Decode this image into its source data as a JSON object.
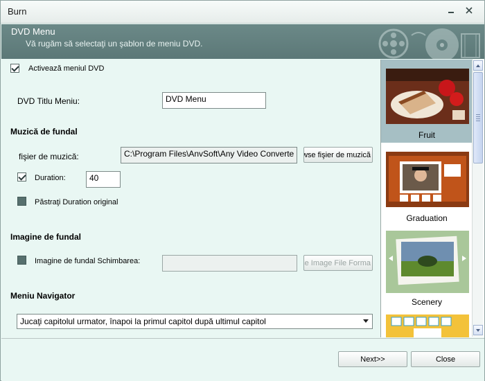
{
  "window": {
    "title": "Burn"
  },
  "header": {
    "title": "DVD Menu",
    "subtitle": "Vă rugăm să selectaţi un şablon de meniu DVD."
  },
  "enable_menu": {
    "label": "Activează meniul DVD",
    "checked": true
  },
  "menu_title": {
    "label": "DVD Titlu Meniu:",
    "value": "DVD Menu"
  },
  "music": {
    "heading": "Muzică de fundal",
    "file_label": "fişier de muzică:",
    "file_value": "C:\\Program Files\\AnvSoft\\Any Video Converte",
    "browse_label": "owse fişier de muzică",
    "duration_label": "Duration:",
    "duration_checked": true,
    "duration_value": "40",
    "keep_label": "Păstraţi Duration original",
    "keep_checked": false
  },
  "image": {
    "heading": "Imagine de fundal",
    "change_label": "Imagine de fundal Schimbarea:",
    "change_checked": false,
    "path_value": "",
    "browse_label": "owse Image File Forma"
  },
  "navigator": {
    "heading": "Meniu Navigator",
    "selected": "Jucaţi capitolul urmator, înapoi la primul capitol după ultimul capitol"
  },
  "templates": {
    "items": [
      {
        "name": "Fruit",
        "selected": true
      },
      {
        "name": "Graduation",
        "selected": false
      },
      {
        "name": "Scenery",
        "selected": false
      }
    ]
  },
  "footer": {
    "next_label": "Next>>",
    "close_label": "Close"
  },
  "colors": {
    "header": "#5f7b7a",
    "background": "#e9f7f3",
    "selected": "#a6bfc4"
  }
}
